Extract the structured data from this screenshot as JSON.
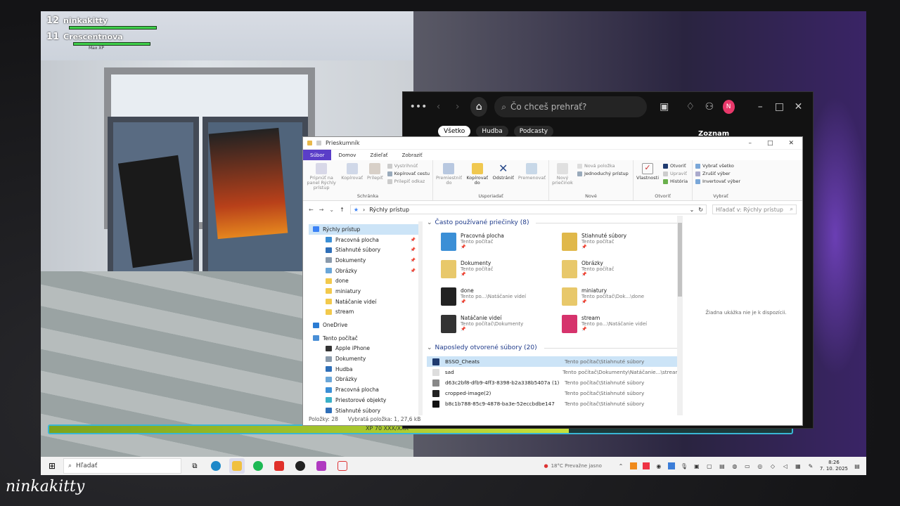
{
  "game": {
    "player_level": "12",
    "player_name": "ninkakitty",
    "pet_level": "11",
    "pet_name": "Crescentnova",
    "pet_xp_label": "Max XP",
    "xp_text": "XP 70 XXX/XXX",
    "xp_fraction": 0.7
  },
  "spotify": {
    "search_placeholder": "Čo chceš prehrať?",
    "chips": [
      "Všetko",
      "Hudba",
      "Podcasty"
    ],
    "library_title": "Zoznam",
    "avatar_letter": "N"
  },
  "explorer": {
    "title": "Prieskumník",
    "tabs": [
      "Súbor",
      "Domov",
      "Zdieľať",
      "Zobraziť"
    ],
    "ribbon": {
      "schranka": {
        "label": "Schránka",
        "pin": "Pripnúť na panel Rýchly prístup",
        "copy": "Kopírovať",
        "paste": "Prilepiť",
        "cut": "Vystrihnúť",
        "copy_path": "Kopírovať cestu",
        "paste_shortcut": "Prilepiť odkaz"
      },
      "usporiadat": {
        "label": "Usporiadať",
        "move": "Premiestniť do",
        "copy_to": "Kopírovať do",
        "delete": "Odstrániť",
        "rename": "Premenovať"
      },
      "nove": {
        "label": "Nové",
        "new_folder": "Nový priečinok",
        "new_item": "Nová položka",
        "easy_access": "Jednoduchý prístup"
      },
      "otvorit": {
        "label": "Otvoriť",
        "properties": "Vlastnosti",
        "open": "Otvoriť",
        "edit": "Upraviť",
        "history": "História"
      },
      "vybrat": {
        "label": "Vybrať",
        "select_all": "Vybrať všetko",
        "select_none": "Zrušiť výber",
        "invert": "Invertovať výber"
      }
    },
    "address": "Rýchly prístup",
    "search_placeholder": "Hľadať v: Rýchly prístup",
    "nav": [
      {
        "label": "Rýchly prístup",
        "top": true,
        "sel": true,
        "color": "#3b82f6"
      },
      {
        "label": "Pracovná plocha",
        "pin": true,
        "color": "#3b8fd6"
      },
      {
        "label": "Stiahnuté súbory",
        "pin": true,
        "color": "#2f6fb8"
      },
      {
        "label": "Dokumenty",
        "pin": true,
        "color": "#8a9aab"
      },
      {
        "label": "Obrázky",
        "pin": true,
        "color": "#6aa6d8"
      },
      {
        "label": "done",
        "color": "#f2c94c"
      },
      {
        "label": "miniatury",
        "color": "#f2c94c"
      },
      {
        "label": "Natáčanie videí",
        "color": "#f2c94c"
      },
      {
        "label": "stream",
        "color": "#f2c94c"
      },
      {
        "label": "OneDrive",
        "top": true,
        "color": "#2b7cd3"
      },
      {
        "label": "Tento počítač",
        "top": true,
        "color": "#4a8fd6"
      },
      {
        "label": "Apple iPhone",
        "color": "#333333"
      },
      {
        "label": "Dokumenty",
        "color": "#8a9aab"
      },
      {
        "label": "Hudba",
        "color": "#2f6fb8"
      },
      {
        "label": "Obrázky",
        "color": "#6aa6d8"
      },
      {
        "label": "Pracovná plocha",
        "color": "#3b8fd6"
      },
      {
        "label": "Priestorové objekty",
        "color": "#3ab0c8"
      },
      {
        "label": "Stiahnuté súbory",
        "color": "#2f6fb8"
      }
    ],
    "frequent_header": "Často používané priečinky (8)",
    "frequent": [
      {
        "name": "Pracovná plocha",
        "sub": "Tento počítač",
        "color": "#3b8fd6"
      },
      {
        "name": "Stiahnuté súbory",
        "sub": "Tento počítač",
        "color": "#e0b84a"
      },
      {
        "name": "Dokumenty",
        "sub": "Tento počítač",
        "color": "#e8c86a"
      },
      {
        "name": "Obrázky",
        "sub": "Tento počítač",
        "color": "#e8c86a"
      },
      {
        "name": "done",
        "sub": "Tento po...\\Natáčanie videí",
        "color": "#222222"
      },
      {
        "name": "miniatury",
        "sub": "Tento počítač\\Dok...\\done",
        "color": "#e8c86a"
      },
      {
        "name": "Natáčanie videí",
        "sub": "Tento počítač\\Dokumenty",
        "color": "#333333"
      },
      {
        "name": "stream",
        "sub": "Tento po...\\Natáčanie videí",
        "color": "#d6336c"
      }
    ],
    "recent_header": "Naposledy otvorené súbory (20)",
    "recent": [
      {
        "name": "BSSO_Cheats",
        "path": "Tento počítač\\Stiahnuté súbory",
        "sel": true,
        "color": "#1f3b70"
      },
      {
        "name": "sad",
        "path": "Tento počítač\\Dokumenty\\Natáčanie...\\stream",
        "color": "#dddddd"
      },
      {
        "name": "d63c2bf8-dfb9-4ff3-8398-b2a338b5407a (1)",
        "path": "Tento počítač\\Stiahnuté súbory",
        "color": "#888888"
      },
      {
        "name": "cropped-image(2)",
        "path": "Tento počítač\\Stiahnuté súbory",
        "color": "#222222"
      },
      {
        "name": "b8c1b788-85c9-4878-ba3e-52eccbdbe147",
        "path": "Tento počítač\\Stiahnuté súbory",
        "color": "#111111"
      }
    ],
    "preview_text": "Žiadna ukážka nie je k dispozícii.",
    "status_count": "Položky: 28",
    "status_selected": "Vybratá položka: 1, 27,6 kB"
  },
  "taskbar": {
    "search_placeholder": "Hľadať",
    "weather": "18°C Prevažne jasno",
    "time": "8:26",
    "date": "7. 10. 2025"
  },
  "signature": "ninkakitty"
}
